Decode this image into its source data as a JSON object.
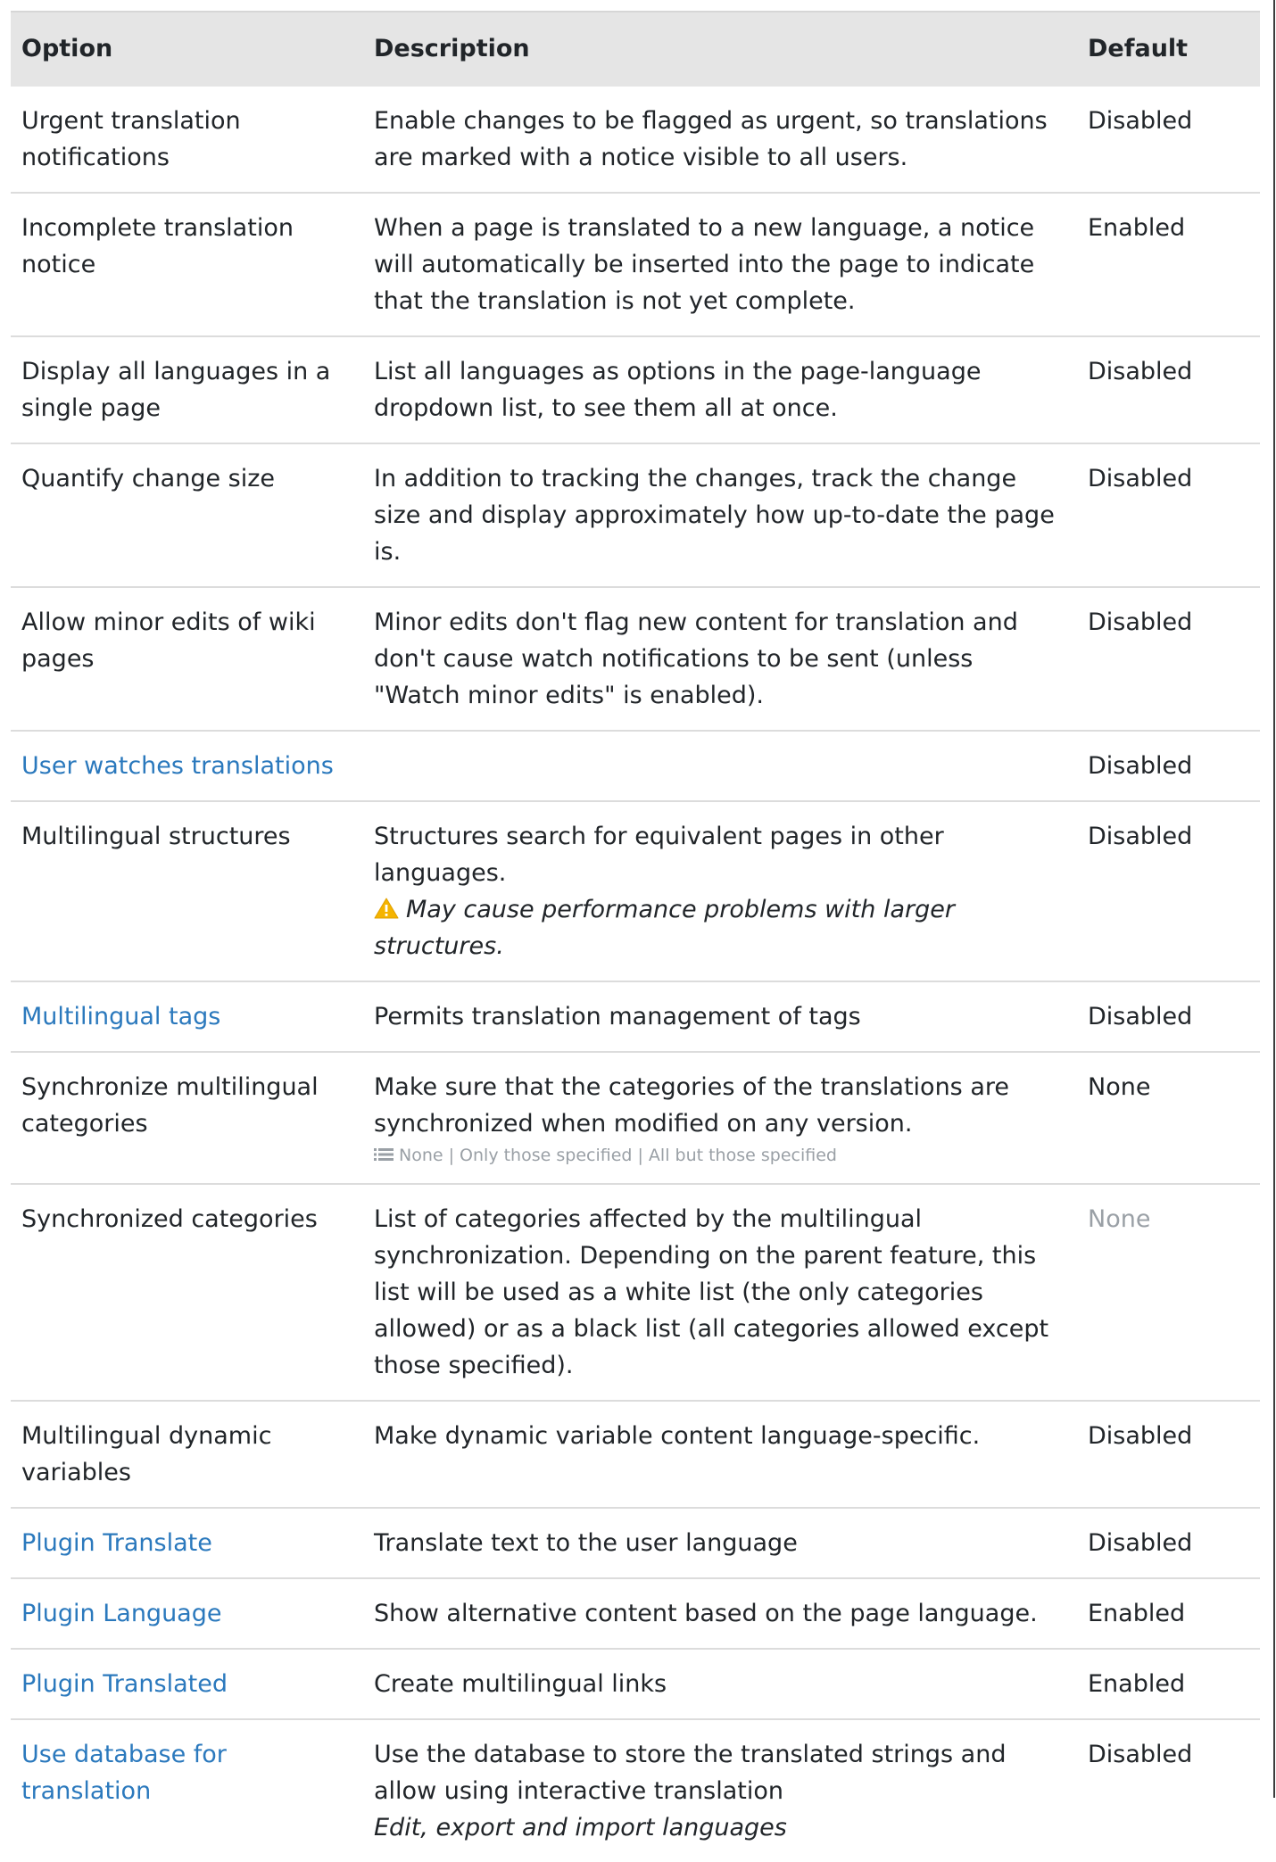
{
  "header": {
    "option": "Option",
    "description": "Description",
    "default": "Default"
  },
  "rows": [
    {
      "option": "Urgent translation notifications",
      "description": "Enable changes to be flagged as urgent, so translations are marked with a notice visible to all users.",
      "default": "Disabled"
    },
    {
      "option": "Incomplete translation notice",
      "description": "When a page is translated to a new language, a notice will automatically be inserted into the page to indicate that the translation is not yet complete.",
      "default": "Enabled"
    },
    {
      "option": "Display all languages in a single page",
      "description": "List all languages as options in the page-language dropdown list, to see them all at once.",
      "default": "Disabled"
    },
    {
      "option": "Quantify change size",
      "description": "In addition to tracking the changes, track the change size and display approximately how up-to-date the page is.",
      "default": "Disabled"
    },
    {
      "option": "Allow minor edits of wiki pages",
      "description": "Minor edits don't flag new content for translation and don't cause watch notifications to be sent (unless \"Watch minor edits\" is enabled).",
      "default": "Disabled"
    },
    {
      "option": "User watches translations",
      "description": "",
      "default": "Disabled",
      "link": true
    },
    {
      "option": "Multilingual structures",
      "description": "Structures search for equivalent pages in other languages.",
      "note": "May cause performance problems with larger structures.",
      "default": "Disabled"
    },
    {
      "option": "Multilingual tags",
      "description": "Permits translation management of tags",
      "default": "Disabled",
      "link": true
    },
    {
      "option": "Synchronize multilingual categories",
      "description": "Make sure that the categories of the translations are synchronized when modified on any version.",
      "choices": "None | Only those specified | All but those specified",
      "default": "None"
    },
    {
      "option": "Synchronized categories",
      "description": "List of categories affected by the multilingual synchronization. Depending on the parent feature, this list will be used as a white list (the only categories allowed) or as a black list (all categories allowed except those specified).",
      "default": "None",
      "default_muted": true
    },
    {
      "option": "Multilingual dynamic variables",
      "description": "Make dynamic variable content language-specific.",
      "default": "Disabled"
    },
    {
      "option": "Plugin Translate",
      "description": "Translate text to the user language",
      "default": "Disabled",
      "link": true
    },
    {
      "option": "Plugin Language",
      "description": "Show alternative content based on the page language.",
      "default": "Enabled",
      "link": true
    },
    {
      "option": "Plugin Translated",
      "description": "Create multilingual links",
      "default": "Enabled",
      "link": true
    },
    {
      "option": "Use database for translation",
      "description": "Use the database to store the translated strings and allow using interactive translation",
      "note": "Edit, export and import languages",
      "default": "Disabled",
      "link": true
    }
  ],
  "icons": {
    "warning": "warning-icon",
    "list": "list-icon"
  },
  "colors": {
    "link": "#2b79bd",
    "header_bg": "#e5e5e5",
    "warning": "#f5b400",
    "muted": "#9aa0a6"
  }
}
